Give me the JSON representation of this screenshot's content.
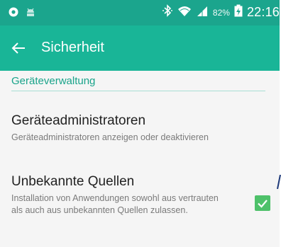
{
  "status_bar": {
    "battery_percent": "82%",
    "time": "22:16",
    "icons": [
      "app-notification-icon",
      "android-notification-icon",
      "bluetooth-icon",
      "wifi-icon",
      "signal-icon",
      "battery-charging-icon"
    ]
  },
  "app_bar": {
    "title": "Sicherheit"
  },
  "section": {
    "header": "Geräteverwaltung"
  },
  "items": [
    {
      "title": "Geräteadministratoren",
      "subtitle": "Geräteadministratoren anzeigen oder deaktivieren"
    },
    {
      "title": "Unbekannte Quellen",
      "subtitle": "Installation von Anwendungen sowohl aus vertrauten als auch aus unbekannten Quellen zulassen.",
      "checked": true
    }
  ],
  "colors": {
    "status_bar": "#1ba58d",
    "app_bar": "#19b597",
    "section_header": "#19a38a",
    "checkbox": "#4ec16a"
  }
}
